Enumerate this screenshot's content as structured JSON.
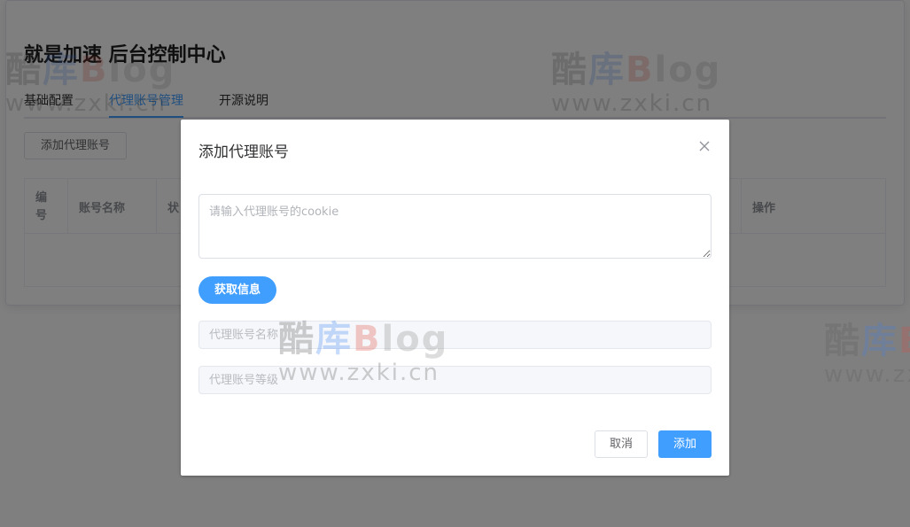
{
  "page": {
    "title": "就是加速 后台控制中心",
    "tabs": [
      {
        "label": "基础配置",
        "active": false
      },
      {
        "label": "代理账号管理",
        "active": true
      },
      {
        "label": "开源说明",
        "active": false
      }
    ],
    "add_proxy_button": "添加代理账号",
    "table": {
      "headers": [
        "编\n号",
        "账号名称",
        "状",
        "操作"
      ]
    }
  },
  "dialog": {
    "title": "添加代理账号",
    "close_icon": "close-icon",
    "cookie_placeholder": "请输入代理账号的cookie",
    "fetch_button": "获取信息",
    "name_placeholder": "代理账号名称",
    "level_placeholder": "代理账号等级",
    "cancel_button": "取消",
    "confirm_button": "添加"
  },
  "watermark": {
    "brand": [
      "酷",
      "库",
      "B",
      "log"
    ],
    "url": "www.zxki.cn"
  },
  "colors": {
    "accent": "#409eff",
    "overlay": "rgba(0,0,0,0.5)"
  }
}
